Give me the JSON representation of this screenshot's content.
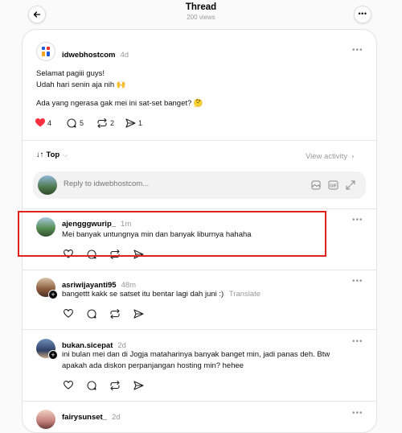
{
  "header": {
    "title": "Thread",
    "views": "200 views"
  },
  "post": {
    "username": "idwebhostcom",
    "time": "4d",
    "lines": [
      "Selamat pagiii guys!",
      "Udah hari senin aja nih 🙌",
      "Ada yang ngerasa gak mei ini sat-set banget? 🤔"
    ],
    "likes": "4",
    "comments": "5",
    "reposts": "2",
    "shares": "1"
  },
  "sort": {
    "label": "Top",
    "view_activity": "View activity"
  },
  "reply": {
    "placeholder": "Reply to idwebhostcom..."
  },
  "replies": [
    {
      "username": "ajengggwurip_",
      "time": "1m",
      "text": "Mei banyak untungnya min dan banyak liburnya hahaha"
    },
    {
      "username": "asriwijayanti95",
      "time": "48m",
      "text": "bangettt kakk se satset itu bentar lagi dah juni :)",
      "translate": "Translate"
    },
    {
      "username": "bukan.sicepat",
      "time": "2d",
      "line1": "ini bulan mei dan di Jogja mataharinya banyak banget min, jadi panas deh. Btw",
      "line2": "apakah ada diskon perpanjangan hosting min? hehee"
    },
    {
      "username": "fairysunset_",
      "time": "2d"
    }
  ],
  "colors": {
    "like": "#ff3040",
    "highlight": "#e0221c"
  }
}
